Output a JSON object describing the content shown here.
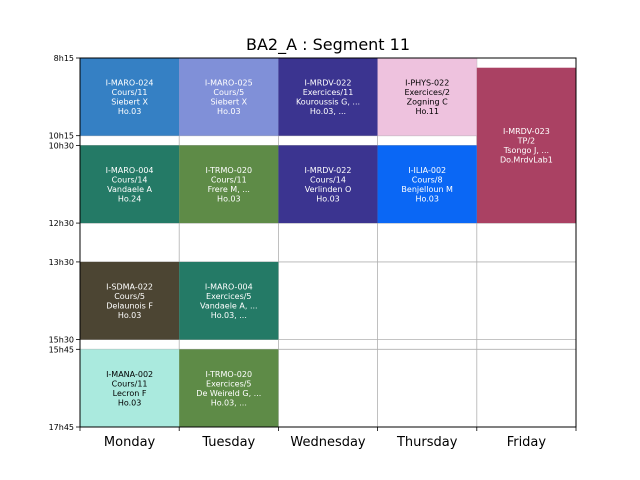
{
  "chart_data": {
    "type": "timetable",
    "title": "BA2_A : Segment 11",
    "days": [
      "Monday",
      "Tuesday",
      "Wednesday",
      "Thursday",
      "Friday"
    ],
    "time_ticks": [
      "8h15",
      "10h15",
      "10h30",
      "12h30",
      "13h30",
      "15h30",
      "15h45",
      "17h45"
    ],
    "time_range": [
      "8h15",
      "17h45"
    ],
    "grid": true,
    "events": [
      {
        "day": "Monday",
        "start": "8h15",
        "end": "10h15",
        "color": "#3580c4",
        "text_color": "#ffffff",
        "lines": [
          "I-MARO-024",
          "Cours/11",
          "Siebert X",
          "Ho.03"
        ]
      },
      {
        "day": "Tuesday",
        "start": "8h15",
        "end": "10h15",
        "color": "#8090d8",
        "text_color": "#ffffff",
        "lines": [
          "I-MARO-025",
          "Cours/5",
          "Siebert X",
          "Ho.03"
        ]
      },
      {
        "day": "Wednesday",
        "start": "8h15",
        "end": "10h15",
        "color": "#3b3490",
        "text_color": "#ffffff",
        "lines": [
          "I-MRDV-022",
          "Exercices/11",
          "Kouroussis G, ...",
          "Ho.03, ..."
        ]
      },
      {
        "day": "Thursday",
        "start": "8h15",
        "end": "10h15",
        "color": "#eec2de",
        "text_color": "#000000",
        "lines": [
          "I-PHYS-022",
          "Exercices/2",
          "Zogning C",
          "Ho.11"
        ]
      },
      {
        "day": "Friday",
        "start": "8h30",
        "end": "12h30",
        "color": "#aa4163",
        "text_color": "#ffffff",
        "lines": [
          "I-MRDV-023",
          "TP/2",
          "Tsongo J, ...",
          "Do.MrdvLab1"
        ]
      },
      {
        "day": "Monday",
        "start": "10h30",
        "end": "12h30",
        "color": "#247a66",
        "text_color": "#ffffff",
        "lines": [
          "I-MARO-004",
          "Cours/14",
          "Vandaele A",
          "Ho.24"
        ]
      },
      {
        "day": "Tuesday",
        "start": "10h30",
        "end": "12h30",
        "color": "#5e8b47",
        "text_color": "#ffffff",
        "lines": [
          "I-TRMO-020",
          "Cours/11",
          "Frere M, ...",
          "Ho.03"
        ]
      },
      {
        "day": "Wednesday",
        "start": "10h30",
        "end": "12h30",
        "color": "#3b3490",
        "text_color": "#ffffff",
        "lines": [
          "I-MRDV-022",
          "Cours/14",
          "Verlinden O",
          "Ho.03"
        ]
      },
      {
        "day": "Thursday",
        "start": "10h30",
        "end": "12h30",
        "color": "#0a67f5",
        "text_color": "#ffffff",
        "lines": [
          "I-ILIA-002",
          "Cours/8",
          "Benjelloun M",
          "Ho.03"
        ]
      },
      {
        "day": "Monday",
        "start": "13h30",
        "end": "15h30",
        "color": "#4c4533",
        "text_color": "#ffffff",
        "lines": [
          "I-SDMA-022",
          "Cours/5",
          "Delaunois F",
          "Ho.03"
        ]
      },
      {
        "day": "Tuesday",
        "start": "13h30",
        "end": "15h30",
        "color": "#247a66",
        "text_color": "#ffffff",
        "lines": [
          "I-MARO-004",
          "Exercices/5",
          "Vandaele A, ...",
          "Ho.03, ..."
        ]
      },
      {
        "day": "Monday",
        "start": "15h45",
        "end": "17h45",
        "color": "#aaeade",
        "text_color": "#000000",
        "lines": [
          "I-MANA-002",
          "Cours/11",
          "Lecron F",
          "Ho.03"
        ]
      },
      {
        "day": "Tuesday",
        "start": "15h45",
        "end": "17h45",
        "color": "#5e8b47",
        "text_color": "#ffffff",
        "lines": [
          "I-TRMO-020",
          "Exercices/5",
          "De Weireld G, ...",
          "Ho.03, ..."
        ]
      }
    ]
  }
}
